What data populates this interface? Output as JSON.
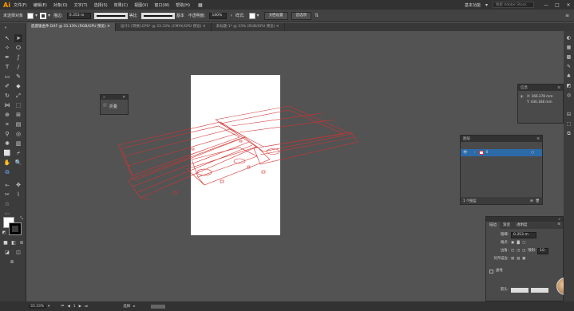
{
  "app": {
    "logo": "Ai",
    "menus": [
      "文件(F)",
      "编辑(E)",
      "对象(O)",
      "文字(T)",
      "选择(S)",
      "效果(C)",
      "视图(V)",
      "窗口(W)",
      "帮助(H)"
    ],
    "workspace": "基本功能",
    "search_placeholder": "搜索 Adobe Stock",
    "win_min": "—",
    "win_max": "□",
    "win_close": "✕"
  },
  "control": {
    "selection": "未选择对象",
    "stroke_label": "描边:",
    "stroke_value": "0.353 m",
    "profile_label": "等比",
    "brush_label": "基本",
    "opacity_label": "不透明度:",
    "opacity_value": "100%",
    "style_label": "样式:",
    "doc_setup": "文档设置",
    "prefs": "首选项"
  },
  "tabs": [
    {
      "label": "底座钣金件.DXF @ 33.33% (RGB/GPU 预览)",
      "active": true
    },
    {
      "label": "设计2 [转换].EPS* @ 33.33% (CMYK/GPU 预览)",
      "active": false
    },
    {
      "label": "未标题-1* @ 33% (RGB/GPU 预览)",
      "active": false
    }
  ],
  "fold_panel": {
    "label": "折叠",
    "close": "✕"
  },
  "info_panel": {
    "title": "信息",
    "x": "X: 166.378 mm",
    "y": "Y: 436.168 mm",
    "w": "宽: 0 mm",
    "h": "高: 0 mm"
  },
  "layers_panel": {
    "title": "图层",
    "layer_name": "0",
    "count": "1 个图层"
  },
  "stroke_panel": {
    "tabs": [
      "描边",
      "渐变",
      "透明度"
    ],
    "weight_label": "粗细:",
    "weight_value": "0.353 m",
    "cap_label": "端点:",
    "corner_label": "边角:",
    "limit_label": "限制:",
    "limit_value": "10",
    "align_label": "对齐描边:",
    "dashed_label": "虚线",
    "arrow_label": "箭头:"
  },
  "status": {
    "zoom": "33.33%",
    "artboard_num": "1",
    "mode": "选择"
  },
  "colors": {
    "accent": "#ff9a00",
    "wire": "#d23232",
    "artboard": "#ffffff",
    "panel_bg": "#4a4a4a",
    "layer_highlight": "#2d6ba8"
  }
}
